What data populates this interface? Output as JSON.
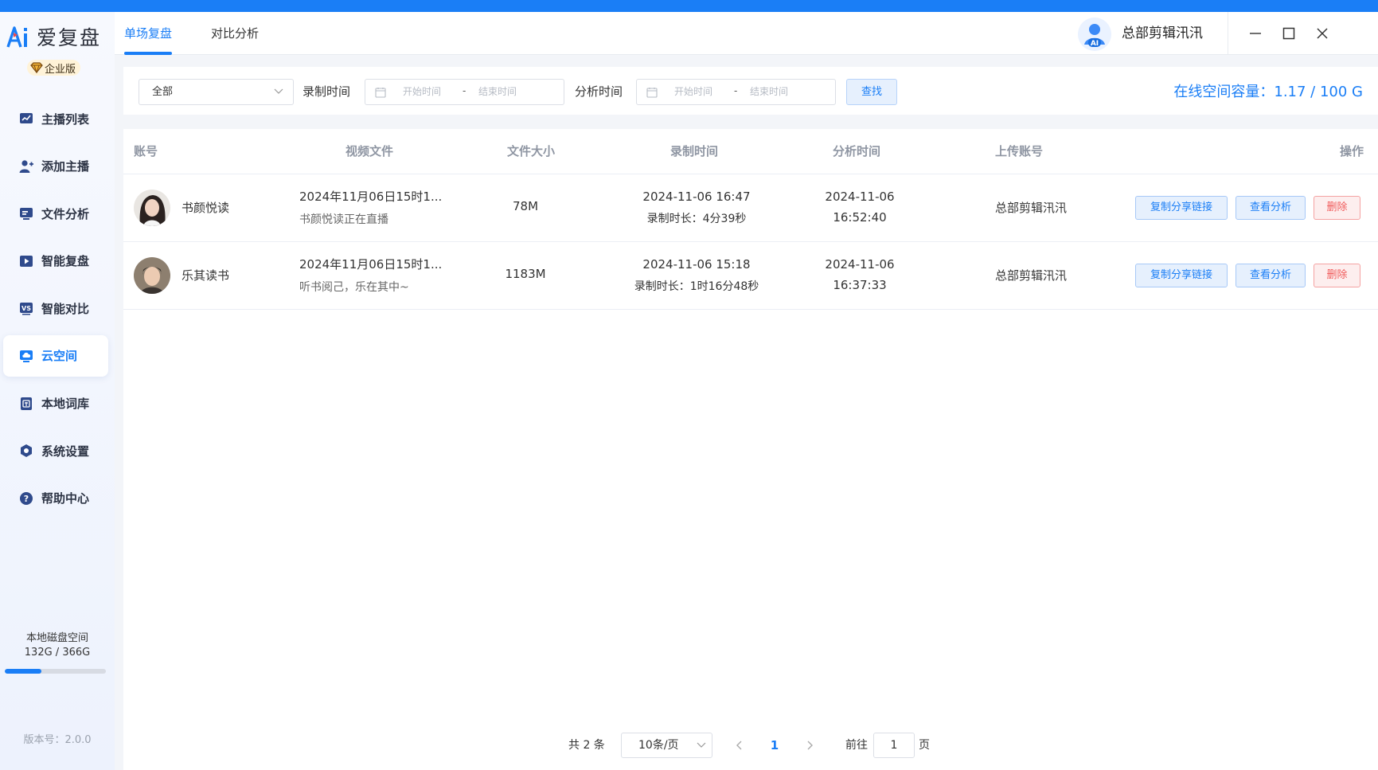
{
  "app": {
    "logo_text": "爱复盘",
    "edition": "企业版",
    "brand_color": "#1a7ef6"
  },
  "sidebar": {
    "items": [
      {
        "label": "主播列表",
        "icon": "chart-line-icon",
        "active": false
      },
      {
        "label": "添加主播",
        "icon": "user-add-icon",
        "active": false
      },
      {
        "label": "文件分析",
        "icon": "monitor-icon",
        "active": false
      },
      {
        "label": "智能复盘",
        "icon": "play-icon",
        "active": false
      },
      {
        "label": "智能对比",
        "icon": "vs-icon",
        "active": false
      },
      {
        "label": "云空间",
        "icon": "cloud-monitor-icon",
        "active": true
      },
      {
        "label": "本地词库",
        "icon": "dictionary-icon",
        "active": false
      },
      {
        "label": "系统设置",
        "icon": "settings-icon",
        "active": false
      },
      {
        "label": "帮助中心",
        "icon": "help-icon",
        "active": false
      }
    ],
    "disk": {
      "label": "本地磁盘空间",
      "usage": "132G / 366G",
      "fraction": 0.36
    },
    "version": "版本号：2.0.0"
  },
  "header": {
    "tabs": [
      {
        "label": "单场复盘",
        "active": true
      },
      {
        "label": "对比分析",
        "active": false
      }
    ],
    "username": "总部剪辑汛汛"
  },
  "filter": {
    "select_value": "全部",
    "record_time_label": "录制时间",
    "analysis_time_label": "分析时间",
    "start_placeholder": "开始时间",
    "range_separator": "-",
    "end_placeholder": "结束时间",
    "find_label": "查找",
    "capacity": "在线空间容量：1.17 / 100 G"
  },
  "table": {
    "columns": [
      "账号",
      "视频文件",
      "文件大小",
      "录制时间",
      "分析时间",
      "上传账号",
      "操作"
    ],
    "rows": [
      {
        "account": "书颜悦读",
        "video_title": "2024年11月06日15时1...",
        "video_desc": "书颜悦读正在直播",
        "size": "78M",
        "record_time": "2024-11-06 16:47",
        "record_duration": "录制时长：4分39秒",
        "analysis_date": "2024-11-06",
        "analysis_clock": "16:52:40",
        "uploader": "总部剪辑汛汛",
        "actions": {
          "copy": "复制分享链接",
          "view": "查看分析",
          "delete": "删除"
        }
      },
      {
        "account": "乐其读书",
        "video_title": "2024年11月06日15时1...",
        "video_desc": "听书阅己，乐在其中~",
        "size": "1183M",
        "record_time": "2024-11-06 15:18",
        "record_duration": "录制时长：1时16分48秒",
        "analysis_date": "2024-11-06",
        "analysis_clock": "16:37:33",
        "uploader": "总部剪辑汛汛",
        "actions": {
          "copy": "复制分享链接",
          "view": "查看分析",
          "delete": "删除"
        }
      }
    ]
  },
  "pagination": {
    "total": "共 2 条",
    "page_size": "10条/页",
    "current_page": "1",
    "goto_label": "前往",
    "goto_value": "1",
    "page_unit": "页"
  }
}
